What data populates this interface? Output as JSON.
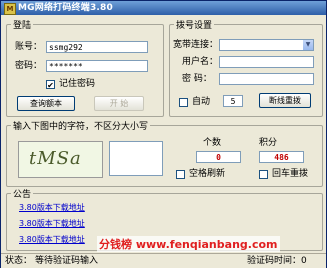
{
  "window": {
    "title": "MG网络打码终端3.80",
    "icon": "app-icon"
  },
  "login": {
    "legend": "登陆",
    "account_label": "账号：",
    "account_value": "ssmg292",
    "password_label": "密码：",
    "password_value": "*******",
    "remember_label": "记住密码",
    "remember_checked": true,
    "query_button": "查询额本",
    "start_button": "开 始"
  },
  "dialup": {
    "legend": "拨号设置",
    "wideband_label": "宽带连接：",
    "username_label": "用户名：",
    "password_label": "密 码：",
    "auto_label": "自动",
    "auto_value": "5",
    "reconnect_button": "断线重拨"
  },
  "captcha": {
    "legend": "输入下图中的字符，不区分大小写",
    "captcha_text": "tMSa",
    "count_label": "个数",
    "count_value": "0",
    "score_label": "积分",
    "score_value": "486",
    "space_refresh_label": "空格刷新",
    "enter_redial_label": "回车重拨"
  },
  "announcement": {
    "legend": "公告",
    "links": [
      "3.80版本下载地址",
      "3.80版本下载地址",
      "3.80版本下载地址"
    ]
  },
  "status": {
    "label": "状态：",
    "text": "等待验证码输入",
    "right_text": "验证码时间：0"
  },
  "watermark": "分钱榜 www.fenqianbang.com"
}
